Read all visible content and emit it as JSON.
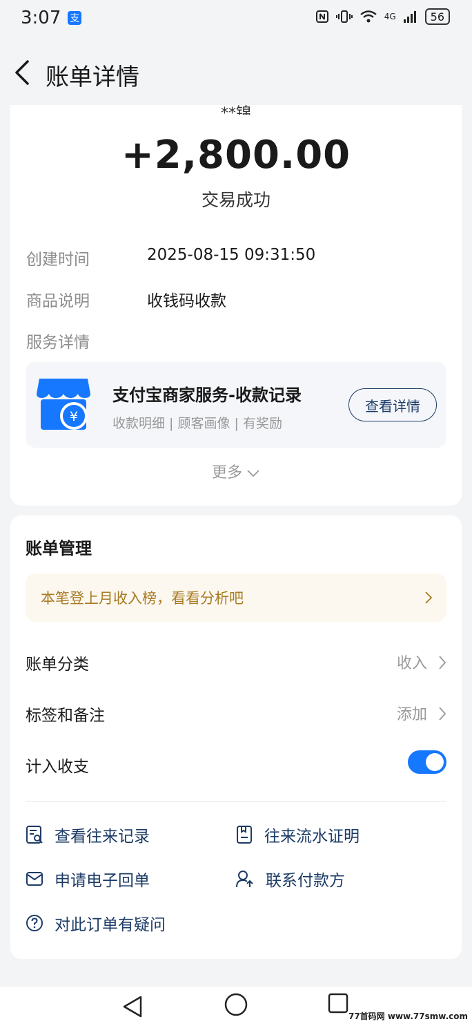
{
  "status_bar": {
    "time": "3:07",
    "app_badge": "支",
    "network": "4G",
    "battery": "56"
  },
  "nav": {
    "title": "账单详情"
  },
  "bill": {
    "counterparty_cut": "**锦",
    "amount": "+2,800.00",
    "status": "交易成功",
    "rows": [
      {
        "label": "创建时间",
        "value": "2025-08-15 09:31:50"
      },
      {
        "label": "商品说明",
        "value": "收钱码收款"
      }
    ],
    "service_label": "服务详情",
    "service": {
      "title": "支付宝商家服务-收款记录",
      "subtitle": "收款明细 | 顾客画像 | 有奖励",
      "button": "查看详情",
      "yen": "¥"
    },
    "more": "更多"
  },
  "management": {
    "title": "账单管理",
    "promo": "本笔登上月收入榜，看看分析吧",
    "rows": [
      {
        "label": "账单分类",
        "value": "收入"
      },
      {
        "label": "标签和备注",
        "value": "添加"
      }
    ],
    "toggle_label": "计入收支",
    "toggle_on": true,
    "links": [
      {
        "label": "查看往来记录",
        "icon": "records-icon"
      },
      {
        "label": "往来流水证明",
        "icon": "statement-icon"
      },
      {
        "label": "申请电子回单",
        "icon": "mail-icon"
      },
      {
        "label": "联系付款方",
        "icon": "contact-user-icon"
      },
      {
        "label": "对此订单有疑问",
        "icon": "question-icon"
      }
    ]
  },
  "watermark": "77首码网 www.77smw.com",
  "colors": {
    "accent": "#1677ff",
    "link": "#1c3b66",
    "promo_text": "#a87a22",
    "promo_bg": "#fcf8ef"
  }
}
